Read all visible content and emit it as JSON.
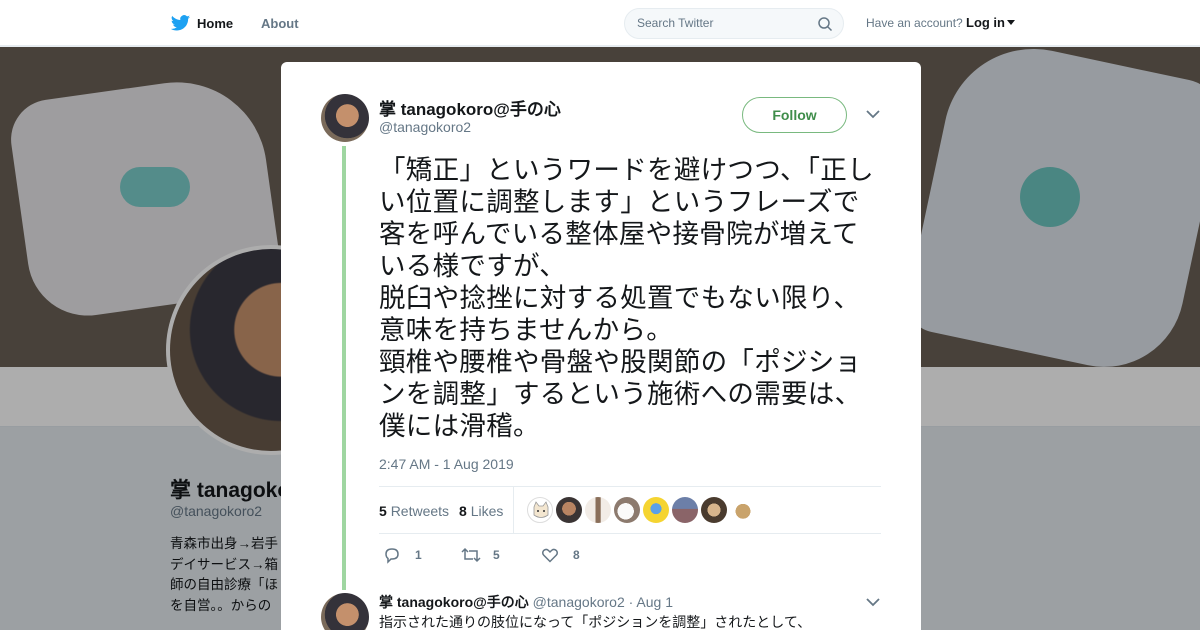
{
  "nav": {
    "home": "Home",
    "about": "About",
    "search_placeholder": "Search Twitter",
    "account_prompt": "Have an account?",
    "login": "Log in"
  },
  "profile": {
    "name": "掌 tanagoko",
    "handle": "@tanagokoro2",
    "bio": "青森市出身→岩手\nデイサービス→箱\n師の自由診療「ほ\nを自営。。からの"
  },
  "tweet": {
    "author_name": "掌 tanagokoro@手の心",
    "author_handle": "@tanagokoro2",
    "follow_label": "Follow",
    "text": "「矯正」というワードを避けつつ、「正しい位置に調整します」というフレーズで客を呼んでいる整体屋や接骨院が増えている様ですが、\n脱臼や捻挫に対する処置でもない限り、意味を持ちませんから。\n頸椎や腰椎や骨盤や股関節の「ポジションを調整」するという施術への需要は、僕には滑稽。",
    "timestamp": "2:47 AM - 1 Aug 2019",
    "retweets_count": "5",
    "retweets_label": "Retweets",
    "likes_count": "8",
    "likes_label": "Likes",
    "reply_count": "1",
    "retweet_action_count": "5",
    "like_action_count": "8"
  },
  "likers": [
    "cat-avatar",
    "person-avatar",
    "figure-avatar",
    "cat-white-avatar",
    "minion-avatar",
    "landscape-avatar",
    "person2-avatar",
    "dog-avatar"
  ],
  "reply": {
    "author_name": "掌 tanagokoro@手の心",
    "author_handle": "@tanagokoro2",
    "separator": "·",
    "date": "Aug 1",
    "text": "指示された通りの肢位になって「ポジションを調整」されたとして、"
  },
  "colors": {
    "twitter_blue": "#1da1f2",
    "thread_line": "#9fd6a1",
    "follow_border": "#79b97f"
  }
}
